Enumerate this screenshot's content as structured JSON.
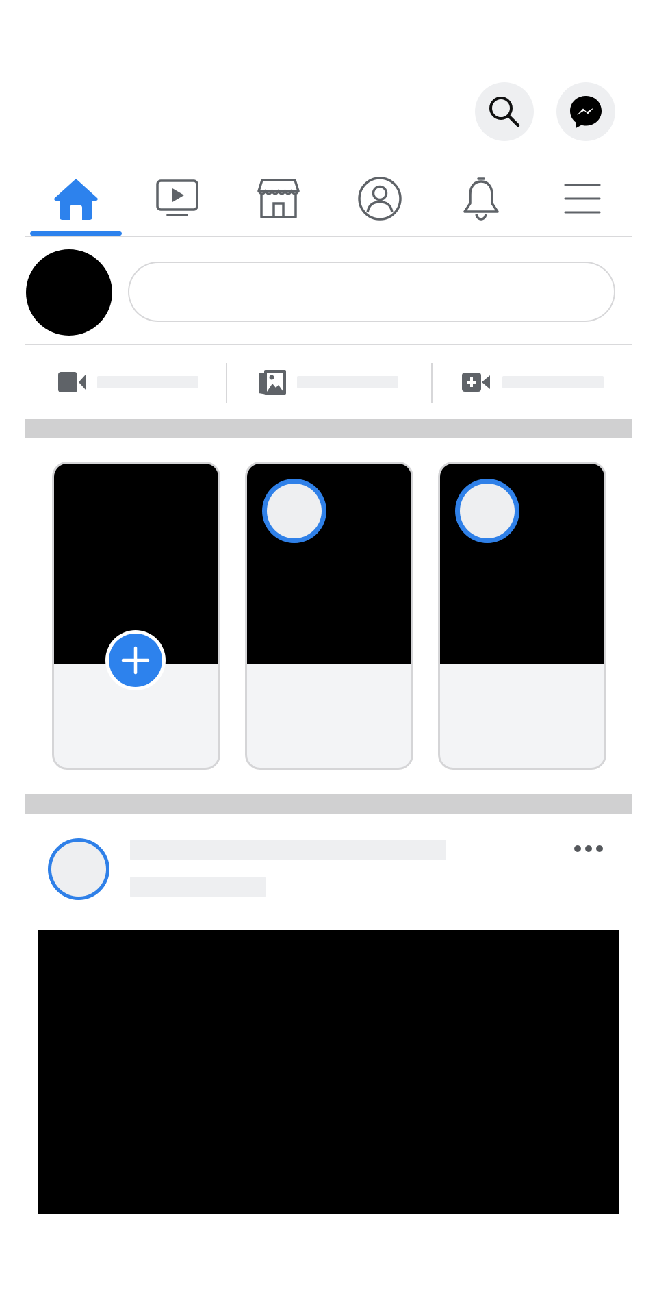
{
  "colors": {
    "accent": "#2d82ed",
    "icon_gray": "#5f6368",
    "skeleton": "#eeeff1",
    "divider": "#d9d9db"
  },
  "header": {
    "buttons": [
      {
        "name": "search",
        "icon": "search-icon"
      },
      {
        "name": "messenger",
        "icon": "messenger-icon"
      }
    ]
  },
  "nav": {
    "active_index": 0,
    "tabs": [
      {
        "name": "home",
        "icon": "home-icon",
        "active": true
      },
      {
        "name": "watch",
        "icon": "video-icon",
        "active": false
      },
      {
        "name": "marketplace",
        "icon": "store-icon",
        "active": false
      },
      {
        "name": "profile",
        "icon": "profile-icon",
        "active": false
      },
      {
        "name": "notifications",
        "icon": "bell-icon",
        "active": false
      },
      {
        "name": "menu",
        "icon": "menu-icon",
        "active": false
      }
    ]
  },
  "composer": {
    "placeholder": "",
    "actions": [
      {
        "name": "live",
        "icon": "live-video-icon"
      },
      {
        "name": "photo",
        "icon": "photo-icon"
      },
      {
        "name": "room",
        "icon": "room-icon"
      }
    ]
  },
  "stories": [
    {
      "type": "create",
      "icon": "plus-icon"
    },
    {
      "type": "story",
      "icon": "avatar"
    },
    {
      "type": "story",
      "icon": "avatar"
    }
  ],
  "post": {
    "more_icon": "more-icon"
  }
}
